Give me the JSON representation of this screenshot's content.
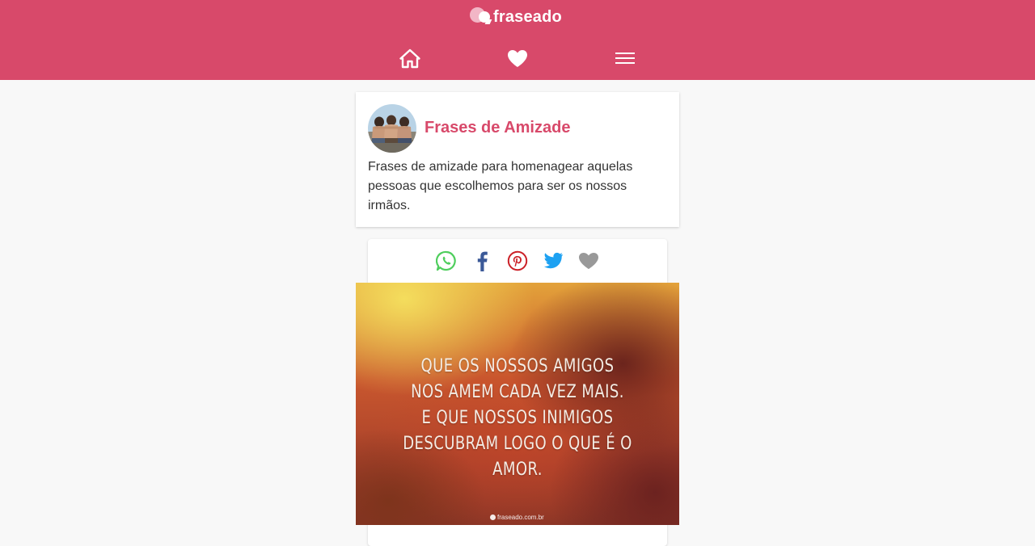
{
  "header": {
    "logo_text": "fraseado",
    "nav": [
      {
        "icon": "home-icon"
      },
      {
        "icon": "heart-icon"
      },
      {
        "icon": "menu-icon"
      }
    ]
  },
  "category": {
    "title": "Frases de Amizade",
    "description": "Frases de amizade para homenagear aquelas pessoas que escolhemos para ser os nossos irmãos."
  },
  "post": {
    "share": [
      {
        "icon": "whatsapp-icon",
        "color": "#4fce5d"
      },
      {
        "icon": "facebook-icon",
        "color": "#3b5998"
      },
      {
        "icon": "pinterest-icon",
        "color": "#cb2027"
      },
      {
        "icon": "twitter-icon",
        "color": "#1da1f2"
      },
      {
        "icon": "heart-icon",
        "color": "#999999"
      }
    ],
    "image": {
      "lines": [
        "QUE OS NOSSOS AMIGOS",
        "NOS AMEM CADA VEZ MAIS.",
        "E QUE NOSSOS INIMIGOS",
        "DESCUBRAM LOGO O QUE É O AMOR."
      ],
      "watermark": "fraseado.com.br"
    }
  },
  "colors": {
    "brand": "#d8496a",
    "background": "#f8f8f8"
  }
}
